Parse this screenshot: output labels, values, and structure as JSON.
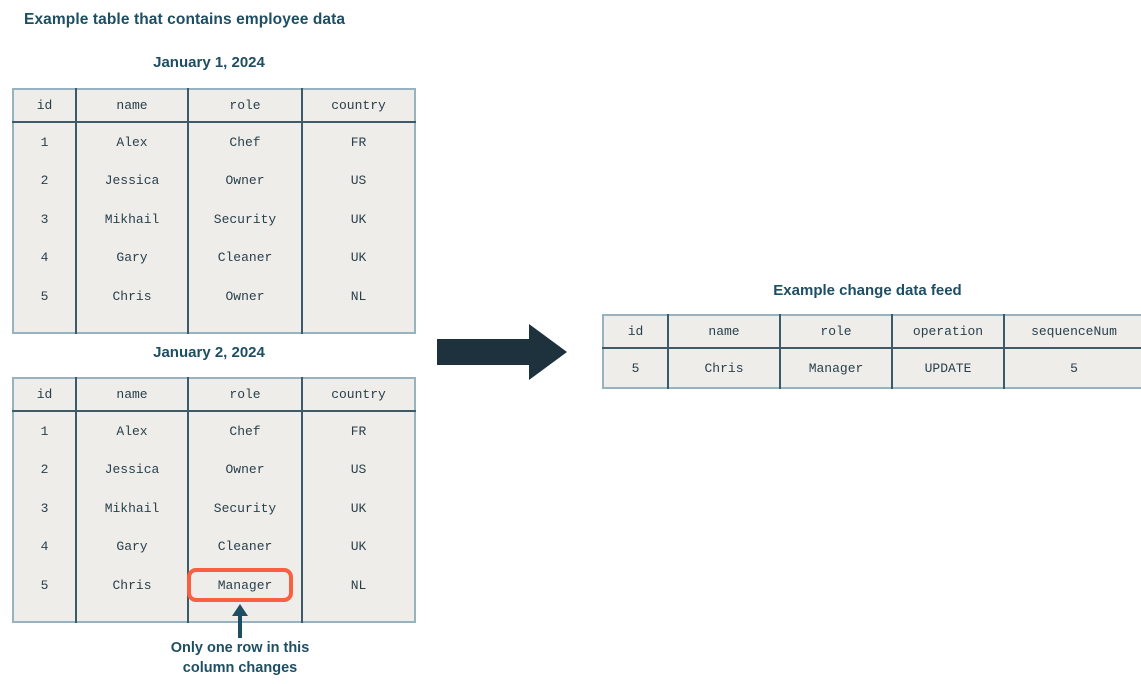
{
  "page": {
    "main_heading": "Example table that contains employee data",
    "background": "#ffffff",
    "heading_color": "#1d4e63",
    "table_fill": "#efedea",
    "table_border_outer": "#97b3c0",
    "table_border_inner": "#3d5a68",
    "arrow_color": "#1d323c",
    "highlight_color": "#fa6040"
  },
  "tables": {
    "jan1": {
      "title": "January 1, 2024",
      "columns": [
        "id",
        "name",
        "role",
        "country"
      ],
      "rows": [
        [
          "1",
          "Alex",
          "Chef",
          "FR"
        ],
        [
          "2",
          "Jessica",
          "Owner",
          "US"
        ],
        [
          "3",
          "Mikhail",
          "Security",
          "UK"
        ],
        [
          "4",
          "Gary",
          "Cleaner",
          "UK"
        ],
        [
          "5",
          "Chris",
          "Owner",
          "NL"
        ]
      ]
    },
    "jan2": {
      "title": "January 2, 2024",
      "columns": [
        "id",
        "name",
        "role",
        "country"
      ],
      "rows": [
        [
          "1",
          "Alex",
          "Chef",
          "FR"
        ],
        [
          "2",
          "Jessica",
          "Owner",
          "US"
        ],
        [
          "3",
          "Mikhail",
          "Security",
          "UK"
        ],
        [
          "4",
          "Gary",
          "Cleaner",
          "UK"
        ],
        [
          "5",
          "Chris",
          "Manager",
          "NL"
        ]
      ],
      "highlighted_cell": {
        "row_index": 4,
        "column": "role",
        "value": "Manager"
      }
    },
    "feed": {
      "title": "Example change data feed",
      "columns": [
        "id",
        "name",
        "role",
        "operation",
        "sequenceNum"
      ],
      "rows": [
        [
          "5",
          "Chris",
          "Manager",
          "UPDATE",
          "5"
        ]
      ]
    }
  },
  "annotation": {
    "line1": "Only one row in this",
    "line2": "column changes"
  },
  "icons": {
    "flow_arrow": "right-arrow-icon",
    "callout_arrow": "up-arrow-icon"
  }
}
